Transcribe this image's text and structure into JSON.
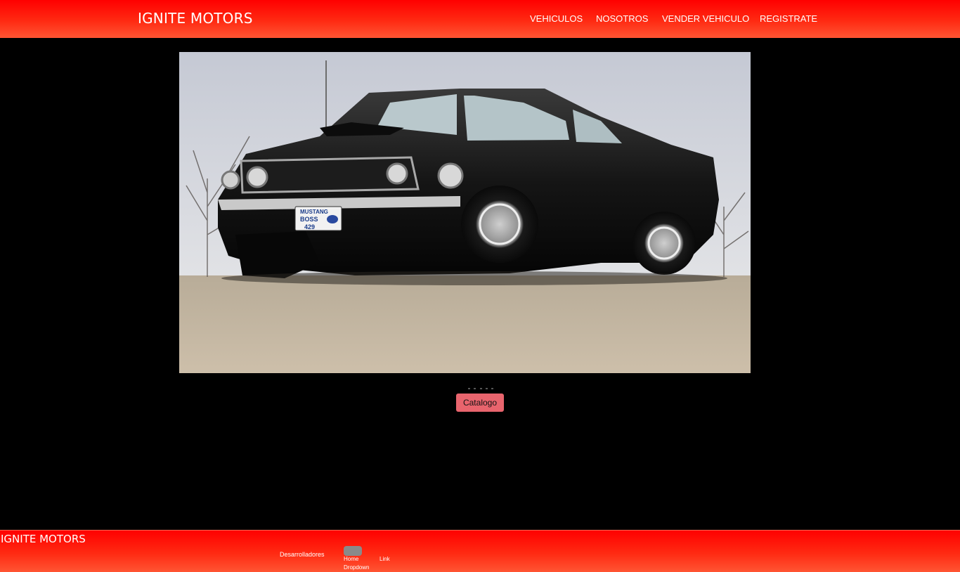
{
  "header": {
    "brand": "IGNITE MOTORS",
    "nav": [
      {
        "label": "VEHICULOS"
      },
      {
        "label": "NOSOTROS"
      },
      {
        "label": "VENDER VEHICULO"
      },
      {
        "label": "REGISTRATE"
      }
    ]
  },
  "hero": {
    "plate_line1": "MUSTANG",
    "plate_line2": "BOSS",
    "plate_line3": "429"
  },
  "carousel": {
    "indicator_count": 5
  },
  "catalog_button": {
    "label": "Catalogo"
  },
  "footer": {
    "brand": "IGNITE MOTORS",
    "developers": "Desarrolladores",
    "home": "Home",
    "link": "Link",
    "dropdown": "Dropdown"
  },
  "colors": {
    "header_red": "#ff0000",
    "button_pink": "#e8646d",
    "background": "#000000"
  }
}
